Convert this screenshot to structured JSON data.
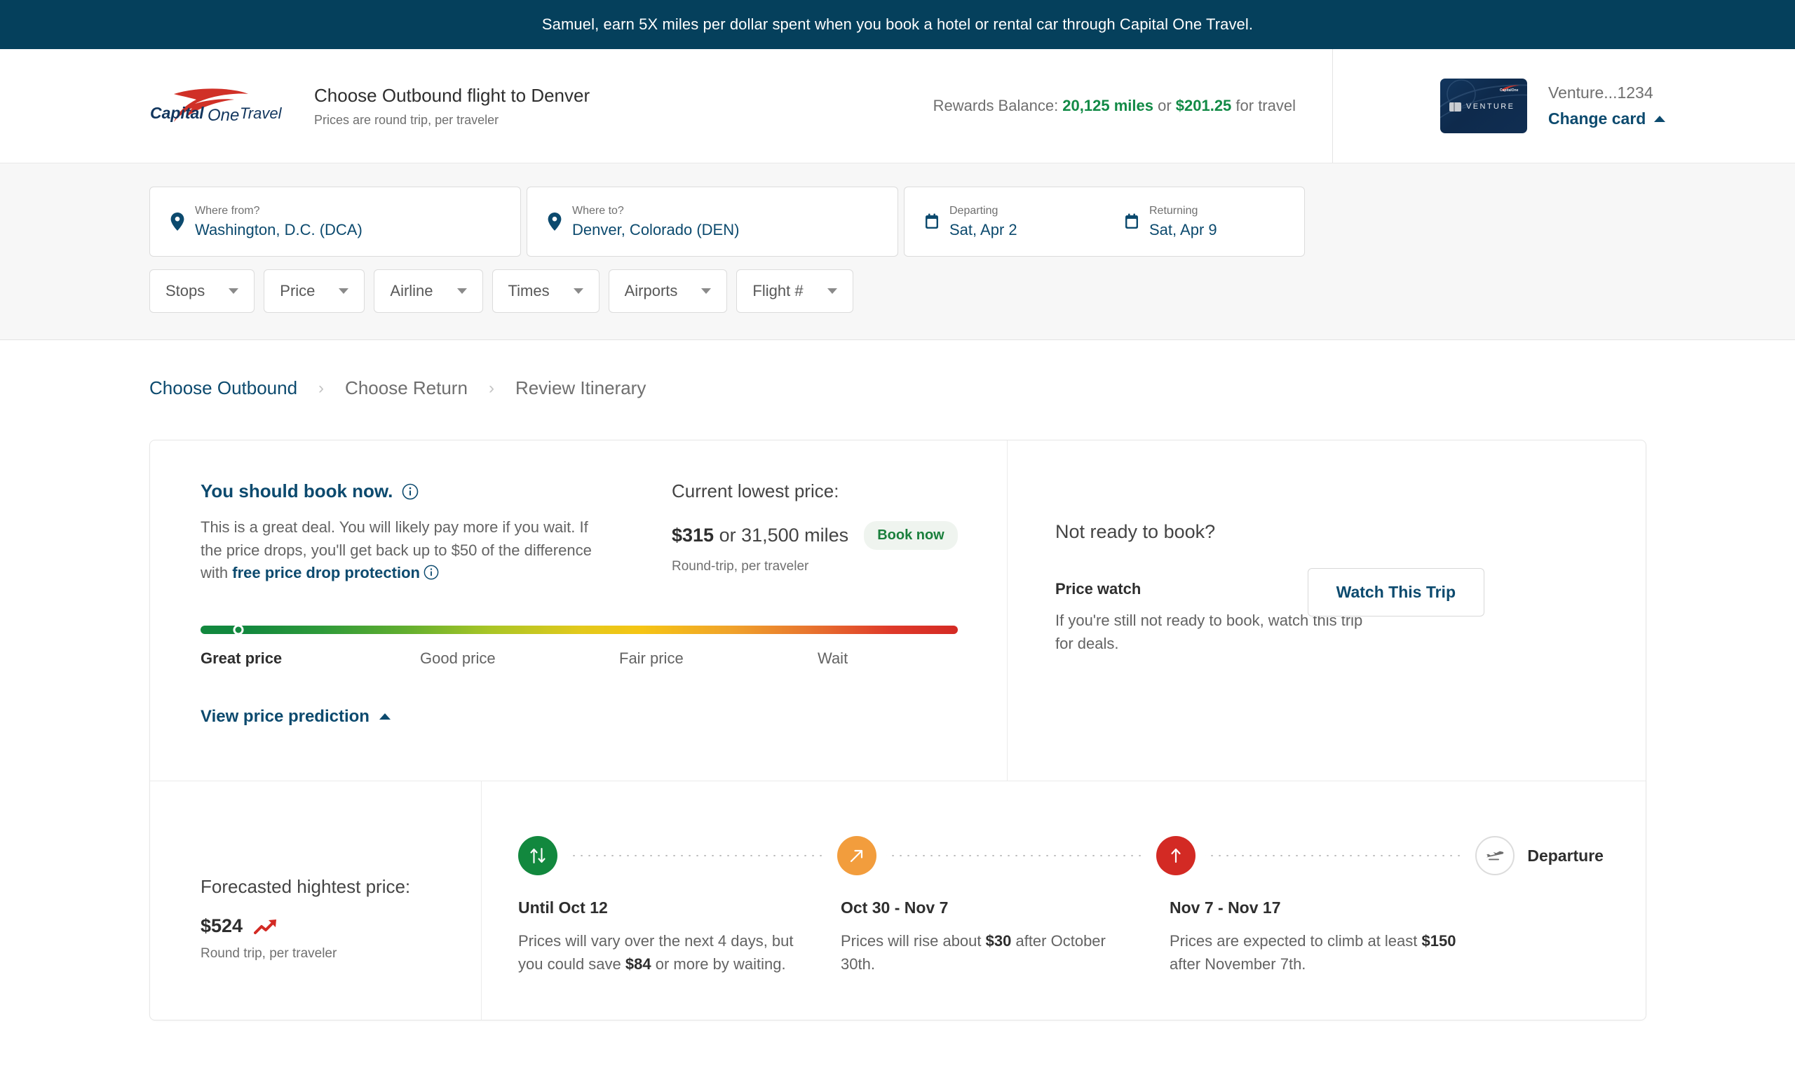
{
  "promo": {
    "text": "Samuel, earn 5X miles per dollar spent when you book a hotel or rental car through Capital One Travel."
  },
  "header": {
    "logo_alt": "Capital One Travel",
    "title": "Choose Outbound flight to Denver",
    "subtitle": "Prices are round trip, per traveler",
    "rewards_prefix": "Rewards Balance: ",
    "rewards_miles": "20,125 miles",
    "rewards_or": " or ",
    "rewards_dollars": "$201.25",
    "rewards_suffix": " for travel",
    "card_name": "Venture...1234",
    "card_art_label": "VENTURE",
    "change_card": "Change card"
  },
  "search": {
    "from_label": "Where from?",
    "from_value": "Washington, D.C. (DCA)",
    "to_label": "Where to?",
    "to_value": "Denver, Colorado (DEN)",
    "departing_label": "Departing",
    "departing_value": "Sat, Apr 2",
    "returning_label": "Returning",
    "returning_value": "Sat, Apr 9",
    "filters": [
      {
        "label": "Stops"
      },
      {
        "label": "Price"
      },
      {
        "label": "Airline"
      },
      {
        "label": "Times"
      },
      {
        "label": "Airports"
      },
      {
        "label": "Flight #"
      }
    ]
  },
  "breadcrumb": {
    "step1": "Choose Outbound",
    "sep1": "›",
    "step2": "Choose Return",
    "sep2": "›",
    "step3": "Review Itinerary"
  },
  "prediction": {
    "book_now_title": "You should book now.",
    "book_now_body_part1": "This is a great deal. You will likely pay more if you wait. If the price drops, you'll get back up to $50 of the difference with ",
    "book_now_body_link": "free price drop protection",
    "lowest_label": "Current lowest price:",
    "lowest_price_amount": "$315",
    "lowest_price_rest": " or 31,500 miles",
    "lowest_badge": "Book now",
    "lowest_sub": "Round-trip, per traveler",
    "gauge_labels": [
      "Great price",
      "Good price",
      "Fair price",
      "Wait"
    ],
    "gauge_marker_percent": 5,
    "view_prediction": "View price prediction",
    "not_ready_title": "Not ready to book?",
    "price_watch_title": "Price watch",
    "price_watch_body": "If you're still not ready to book, watch this trip for deals.",
    "watch_button": "Watch This Trip"
  },
  "forecast": {
    "label": "Forecasted hightest price:",
    "price": "$524",
    "sub": "Round trip, per traveler",
    "departure_label": "Departure",
    "segments": [
      {
        "icon": "up-down-arrows-icon",
        "color": "#12883E",
        "range": "Until Oct 12",
        "body_pre": "Prices will vary over the next 4 days, but you could save ",
        "body_amount": "$84",
        "body_post": " or more by waiting."
      },
      {
        "icon": "arrow-up-right-icon",
        "color": "#F29D3D",
        "range": "Oct 30 - Nov 7",
        "body_pre": "Prices will rise about ",
        "body_amount": "$30",
        "body_post": " after October 30th."
      },
      {
        "icon": "arrow-up-icon",
        "color": "#D32A24",
        "range": "Nov 7 - Nov 17",
        "body_pre": "Prices are expected to climb at least ",
        "body_amount": "$150",
        "body_post": " after November 7th."
      }
    ]
  },
  "colors": {
    "banner": "#05405C",
    "brand_blue": "#0C4A6E",
    "brand_red": "#D03027",
    "green": "#128A46",
    "timeline_green": "#12883E",
    "timeline_orange": "#F29D3D",
    "timeline_red": "#D32A24"
  }
}
